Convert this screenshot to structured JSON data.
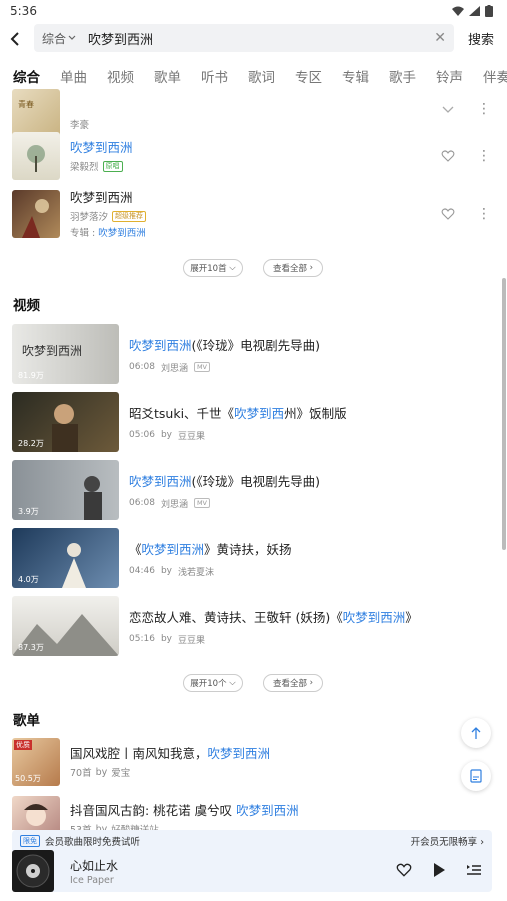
{
  "status": {
    "time": "5:36"
  },
  "search": {
    "category": "综合",
    "query": "吹梦到西洲",
    "button": "搜索"
  },
  "tabs": [
    "综合",
    "单曲",
    "视频",
    "歌单",
    "听书",
    "歌词",
    "专区",
    "专辑",
    "歌手",
    "铃声",
    "伴奏"
  ],
  "songs": [
    {
      "title": "",
      "title_hl": "",
      "artist": "李豪",
      "badge": "",
      "album_prefix": "",
      "album": ""
    },
    {
      "title": "",
      "title_hl": "吹梦到西洲",
      "artist": "梁毅烈",
      "badge": "原唱",
      "album_prefix": "",
      "album": ""
    },
    {
      "title": "吹梦到西洲",
      "title_hl": "",
      "artist": "羽梦落汐",
      "badge": "超级推荐",
      "album_prefix": "专辑 : ",
      "album": "吹梦到西洲"
    }
  ],
  "songs_more": {
    "expand": "展开10首",
    "all": "查看全部"
  },
  "video_section": {
    "title": "视频"
  },
  "videos": [
    {
      "pre": "",
      "hl": "吹梦到西洲",
      "post": "(《玲珑》电视剧先导曲)",
      "duration": "06:08",
      "author": "刘思涵",
      "mv": "MV",
      "count": "81.9万",
      "by": ""
    },
    {
      "pre": "昭爻tsuki、千世《",
      "hl": "吹梦到西",
      "post": "州》饭制版",
      "duration": "05:06",
      "author": "豆豆果",
      "mv": "",
      "count": "28.2万",
      "by": "by"
    },
    {
      "pre": "",
      "hl": "吹梦到西洲",
      "post": "(《玲珑》电视剧先导曲)",
      "duration": "06:08",
      "author": "刘思涵",
      "mv": "MV",
      "count": "3.9万",
      "by": ""
    },
    {
      "pre": "《",
      "hl": "吹梦到西洲",
      "post": "》黄诗扶，妖扬",
      "duration": "04:46",
      "author": "浅若夏沫",
      "mv": "",
      "count": "4.0万",
      "by": "by"
    },
    {
      "pre": "恋恋故人难、黄诗扶、王敬轩 (妖扬)《",
      "hl": "吹梦到西洲",
      "post": "》",
      "duration": "05:16",
      "author": "豆豆果",
      "mv": "",
      "count": "87.3万",
      "by": "by"
    }
  ],
  "videos_more": {
    "expand": "展开10个",
    "all": "查看全部"
  },
  "playlist_section": {
    "title": "歌单"
  },
  "playlists": [
    {
      "pre": "国风戏腔丨南风知我意，",
      "hl": "吹梦到西洲",
      "count_label": "70首",
      "by": "by",
      "author": "爱宝",
      "plays": "50.5万",
      "cover_tag": "优质"
    },
    {
      "pre": "抖音国风古韵: 桃花诺 虞兮叹 ",
      "hl": "吹梦到西洲",
      "count_label": "53首",
      "by": "by",
      "author": "好酸糖送站",
      "plays": "",
      "cover_tag": ""
    }
  ],
  "vip": {
    "tag": "限免",
    "text": "会员歌曲限时免费试听",
    "cta": "开会员无限畅享"
  },
  "player": {
    "title": "心如止水",
    "artist": "Ice Paper"
  },
  "colors": {
    "accent": "#2f7fe0",
    "text": "#222222",
    "muted": "#888888"
  }
}
